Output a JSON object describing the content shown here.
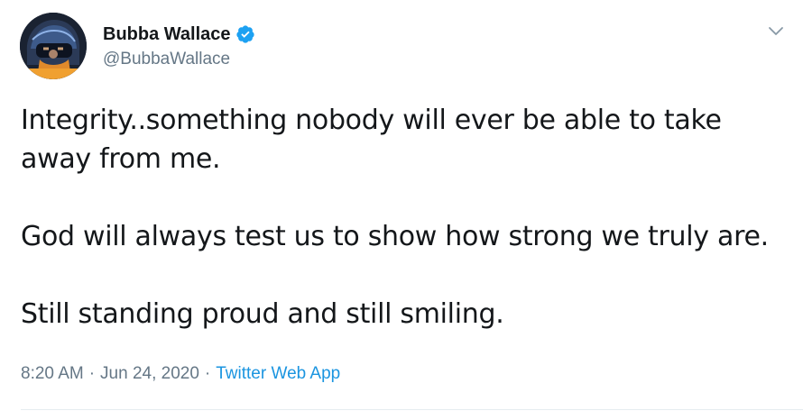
{
  "user": {
    "display_name": "Bubba Wallace",
    "handle": "@BubbaWallace",
    "verified": true
  },
  "tweet": {
    "paragraphs": [
      "Integrity..something nobody will ever be able to take",
      "away from me.",
      "God will always test us to show how strong we truly are.",
      "Still standing proud and still smiling."
    ],
    "time": "8:20 AM",
    "separator": "·",
    "date": "Jun 24, 2020",
    "source": "Twitter Web App"
  },
  "icons": {
    "verified": "verified-badge-icon",
    "caret": "chevron-down-icon",
    "avatar": "profile-avatar"
  },
  "colors": {
    "text": "#14171a",
    "muted": "#657786",
    "link": "#1b95e0",
    "verified": "#1da1f2",
    "divider": "#e6ecf0"
  }
}
